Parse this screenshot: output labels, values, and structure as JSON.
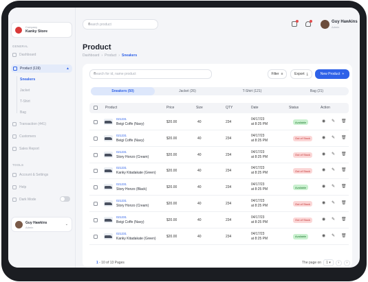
{
  "store": {
    "caption": "Company",
    "name": "Kanky Store"
  },
  "sidebar": {
    "general_label": "GENERAL",
    "tools_label": "TOOLS",
    "items": [
      {
        "label": "Dashboard",
        "icon": "grid-icon"
      },
      {
        "label": "Product (119)",
        "icon": "box-icon"
      },
      {
        "label": "Transaction (441)",
        "icon": "receipt-icon"
      },
      {
        "label": "Customers",
        "icon": "users-icon"
      },
      {
        "label": "Sales Report",
        "icon": "chart-icon"
      }
    ],
    "sub_items": [
      "Sneakers",
      "Jacket",
      "T-Shirt",
      "Bag"
    ],
    "tools": [
      {
        "label": "Account & Settings",
        "icon": "gear-icon"
      },
      {
        "label": "Help",
        "icon": "help-icon"
      },
      {
        "label": "Dark Mode",
        "icon": "moon-icon"
      }
    ],
    "user": {
      "name": "Guy Hawkins",
      "role": "Admin"
    }
  },
  "top": {
    "search_placeholder": "Search product",
    "user": {
      "name": "Guy Hawkins",
      "role": "Admin"
    }
  },
  "page": {
    "title": "Product",
    "breadcrumb": [
      "Dashboard",
      "Product",
      "Sneakers"
    ]
  },
  "toolbar": {
    "search_placeholder": "Search for id, name product",
    "filter_label": "Filter",
    "export_label": "Export",
    "new_label": "New Product"
  },
  "tabs": [
    "Sneakers (50)",
    "Jacket (26)",
    "T-Shirt (121)",
    "Bag (21)"
  ],
  "table": {
    "headers": [
      "Product",
      "Price",
      "Size",
      "QTY",
      "Date",
      "Status",
      "Action"
    ],
    "rows": [
      {
        "id": "021231",
        "name": "Beigi Coffe (Navy)",
        "price": "$20.00",
        "size": "40",
        "qty": "234",
        "date": "04/17/23",
        "time": "at 8:25 PM",
        "status": "Available"
      },
      {
        "id": "021231",
        "name": "Beigi Coffe (Navy)",
        "price": "$20.00",
        "size": "40",
        "qty": "234",
        "date": "04/17/23",
        "time": "at 8:25 PM",
        "status": "Out of Stock"
      },
      {
        "id": "021231",
        "name": "Story Honzo (Cream)",
        "price": "$20.00",
        "size": "40",
        "qty": "234",
        "date": "04/17/23",
        "time": "at 8:25 PM",
        "status": "Out of Stock"
      },
      {
        "id": "021231",
        "name": "Kanky Kitadakate (Green)",
        "price": "$20.00",
        "size": "40",
        "qty": "234",
        "date": "04/17/23",
        "time": "at 8:25 PM",
        "status": "Out of Stock"
      },
      {
        "id": "021231",
        "name": "Story Honzo (Black)",
        "price": "$20.00",
        "size": "40",
        "qty": "234",
        "date": "04/17/23",
        "time": "at 8:25 PM",
        "status": "Available"
      },
      {
        "id": "021231",
        "name": "Story Honzo (Cream)",
        "price": "$20.00",
        "size": "40",
        "qty": "234",
        "date": "04/17/23",
        "time": "at 8:25 PM",
        "status": "Out of Stock"
      },
      {
        "id": "021231",
        "name": "Beigi Coffe (Navy)",
        "price": "$20.00",
        "size": "40",
        "qty": "234",
        "date": "04/17/23",
        "time": "at 8:25 PM",
        "status": "Out of Stock"
      },
      {
        "id": "021231",
        "name": "Kanky Kitadakate (Green)",
        "price": "$20.00",
        "size": "40",
        "qty": "234",
        "date": "04/17/23",
        "time": "at 8:25 PM",
        "status": "Available"
      }
    ]
  },
  "footer": {
    "range_start": "1",
    "range_rest": " - 10 of 13 Pages",
    "page_label": "The page on",
    "page_value": "1"
  },
  "colors": {
    "accent": "#2f62e8",
    "available_bg": "#c9f0cf",
    "available_fg": "#1e7a2e",
    "out_bg": "#fbd6d6",
    "out_fg": "#c23232"
  }
}
